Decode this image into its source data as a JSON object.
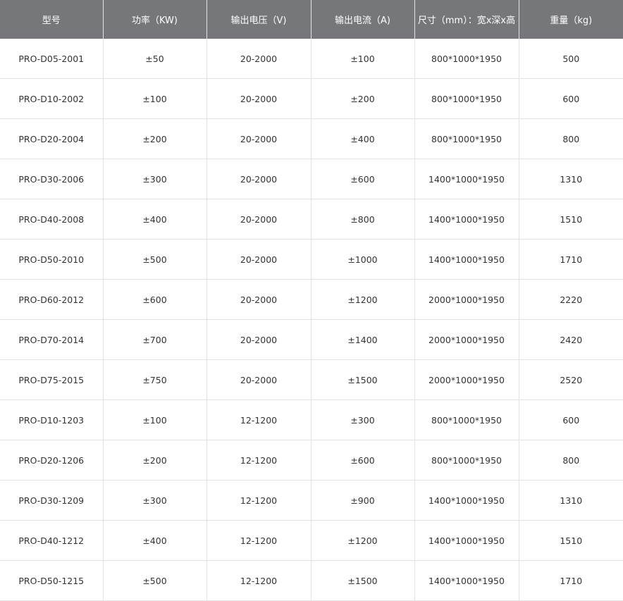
{
  "table": {
    "headers": [
      "型号",
      "功率（KW)",
      "输出电压（V)",
      "输出电流（A)",
      "尺寸（mm）：宽x深x高",
      "重量（kg)"
    ],
    "rows": [
      [
        "PRO-D05-2001",
        "±50",
        "20-2000",
        "±100",
        "800*1000*1950",
        "500"
      ],
      [
        "PRO-D10-2002",
        "±100",
        "20-2000",
        "±200",
        "800*1000*1950",
        "600"
      ],
      [
        "PRO-D20-2004",
        "±200",
        "20-2000",
        "±400",
        "800*1000*1950",
        "800"
      ],
      [
        "PRO-D30-2006",
        "±300",
        "20-2000",
        "±600",
        "1400*1000*1950",
        "1310"
      ],
      [
        "PRO-D40-2008",
        "±400",
        "20-2000",
        "±800",
        "1400*1000*1950",
        "1510"
      ],
      [
        "PRO-D50-2010",
        "±500",
        "20-2000",
        "±1000",
        "1400*1000*1950",
        "1710"
      ],
      [
        "PRO-D60-2012",
        "±600",
        "20-2000",
        "±1200",
        "2000*1000*1950",
        "2220"
      ],
      [
        "PRO-D70-2014",
        "±700",
        "20-2000",
        "±1400",
        "2000*1000*1950",
        "2420"
      ],
      [
        "PRO-D75-2015",
        "±750",
        "20-2000",
        "±1500",
        "2000*1000*1950",
        "2520"
      ],
      [
        "PRO-D10-1203",
        "±100",
        "12-1200",
        "±300",
        "800*1000*1950",
        "600"
      ],
      [
        "PRO-D20-1206",
        "±200",
        "12-1200",
        "±600",
        "800*1000*1950",
        "800"
      ],
      [
        "PRO-D30-1209",
        "±300",
        "12-1200",
        "±900",
        "1400*1000*1950",
        "1310"
      ],
      [
        "PRO-D40-1212",
        "±400",
        "12-1200",
        "±1200",
        "1400*1000*1950",
        "1510"
      ],
      [
        "PRO-D50-1215",
        "±500",
        "12-1200",
        "±1500",
        "1400*1000*1950",
        "1710"
      ]
    ]
  }
}
